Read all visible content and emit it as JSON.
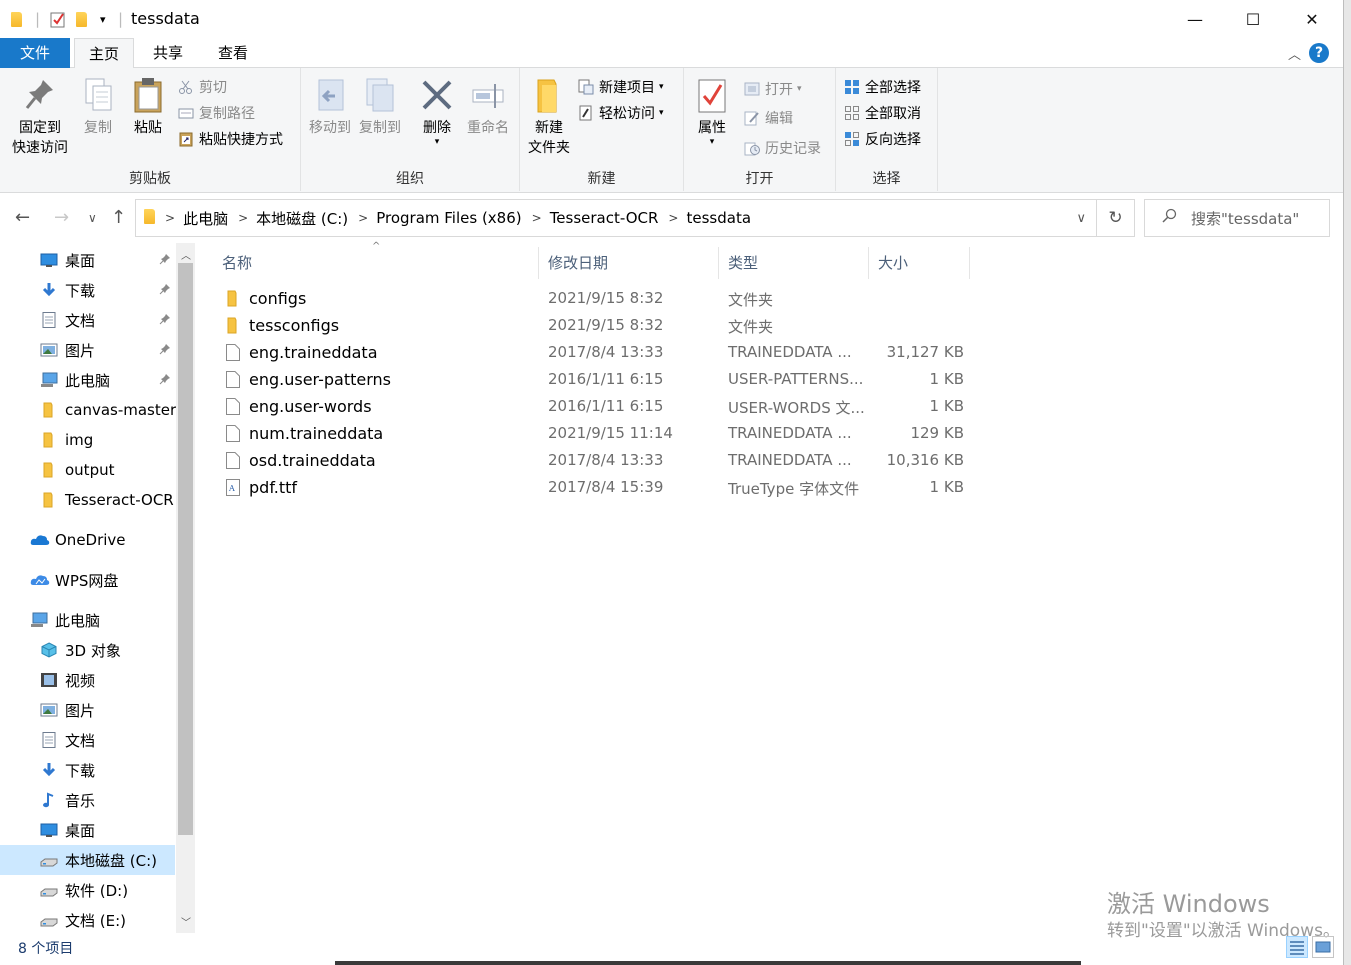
{
  "window": {
    "title": "tessdata",
    "controls": {
      "minimize": "—",
      "maximize": "☐",
      "close": "✕"
    }
  },
  "tabs": [
    {
      "label": "文件"
    },
    {
      "label": "主页"
    },
    {
      "label": "共享"
    },
    {
      "label": "查看"
    }
  ],
  "help_label": "?",
  "ribbon": {
    "clipboard": {
      "group_label": "剪贴板",
      "pin_label_line1": "固定到",
      "pin_label_line2": "快速访问",
      "copy_label": "复制",
      "paste_label": "粘贴",
      "cut_label": "剪切",
      "copy_path_label": "复制路径",
      "paste_shortcut_label": "粘贴快捷方式"
    },
    "organize": {
      "group_label": "组织",
      "move_to_label": "移动到",
      "copy_to_label": "复制到",
      "delete_label": "删除",
      "rename_label": "重命名"
    },
    "new": {
      "group_label": "新建",
      "new_folder_line1": "新建",
      "new_folder_line2": "文件夹",
      "new_item_label": "新建项目",
      "easy_access_label": "轻松访问"
    },
    "open": {
      "group_label": "打开",
      "properties_label": "属性",
      "open_label": "打开",
      "edit_label": "编辑",
      "history_label": "历史记录"
    },
    "select": {
      "group_label": "选择",
      "select_all_label": "全部选择",
      "select_none_label": "全部取消",
      "invert_label": "反向选择"
    }
  },
  "address": {
    "crumbs": [
      "此电脑",
      "本地磁盘 (C:)",
      "Program Files (x86)",
      "Tesseract-OCR",
      "tessdata"
    ]
  },
  "search": {
    "placeholder": "搜索\"tessdata\""
  },
  "navpane": {
    "quick_access": [
      {
        "label": "桌面",
        "icon": "desktop-icon",
        "pinned": true
      },
      {
        "label": "下载",
        "icon": "download-icon",
        "pinned": true
      },
      {
        "label": "文档",
        "icon": "document-icon",
        "pinned": true
      },
      {
        "label": "图片",
        "icon": "picture-icon",
        "pinned": true
      },
      {
        "label": "此电脑",
        "icon": "computer-icon",
        "pinned": true
      },
      {
        "label": "canvas-master",
        "icon": "folder-icon",
        "pinned": false
      },
      {
        "label": "img",
        "icon": "folder-icon",
        "pinned": false
      },
      {
        "label": "output",
        "icon": "folder-icon",
        "pinned": false
      },
      {
        "label": "Tesseract-OCR",
        "icon": "folder-icon",
        "pinned": false
      }
    ],
    "onedrive": "OneDrive",
    "wps": "WPS网盘",
    "this_pc": "此电脑",
    "pc_items": [
      {
        "label": "3D 对象",
        "icon": "3d-objects-icon"
      },
      {
        "label": "视频",
        "icon": "video-icon"
      },
      {
        "label": "图片",
        "icon": "picture-icon"
      },
      {
        "label": "文档",
        "icon": "document-icon"
      },
      {
        "label": "下载",
        "icon": "download-icon"
      },
      {
        "label": "音乐",
        "icon": "music-icon"
      },
      {
        "label": "桌面",
        "icon": "desktop-icon"
      },
      {
        "label": "本地磁盘 (C:)",
        "icon": "drive-icon",
        "selected": true
      },
      {
        "label": "软件 (D:)",
        "icon": "drive-icon"
      },
      {
        "label": "文档 (E:)",
        "icon": "drive-icon"
      }
    ]
  },
  "columns": {
    "name": "名称",
    "date": "修改日期",
    "type": "类型",
    "size": "大小"
  },
  "files": [
    {
      "name": "configs",
      "date": "2021/9/15 8:32",
      "type": "文件夹",
      "size": "",
      "kind": "folder"
    },
    {
      "name": "tessconfigs",
      "date": "2021/9/15 8:32",
      "type": "文件夹",
      "size": "",
      "kind": "folder"
    },
    {
      "name": "eng.traineddata",
      "date": "2017/8/4 13:33",
      "type": "TRAINEDDATA ...",
      "size": "31,127 KB",
      "kind": "file"
    },
    {
      "name": "eng.user-patterns",
      "date": "2016/1/11 6:15",
      "type": "USER-PATTERNS...",
      "size": "1 KB",
      "kind": "file"
    },
    {
      "name": "eng.user-words",
      "date": "2016/1/11 6:15",
      "type": "USER-WORDS 文...",
      "size": "1 KB",
      "kind": "file"
    },
    {
      "name": "num.traineddata",
      "date": "2021/9/15 11:14",
      "type": "TRAINEDDATA ...",
      "size": "129 KB",
      "kind": "file"
    },
    {
      "name": "osd.traineddata",
      "date": "2017/8/4 13:33",
      "type": "TRAINEDDATA ...",
      "size": "10,316 KB",
      "kind": "file"
    },
    {
      "name": "pdf.ttf",
      "date": "2017/8/4 15:39",
      "type": "TrueType 字体文件",
      "size": "1 KB",
      "kind": "font"
    }
  ],
  "status": {
    "count": "8 个项目"
  },
  "watermark": {
    "line1": "激活 Windows",
    "line2": "转到\"设置\"以激活 Windows。"
  },
  "colors": {
    "accent": "#1979ca",
    "selected": "#cce8ff",
    "folder": "#f6c342"
  }
}
